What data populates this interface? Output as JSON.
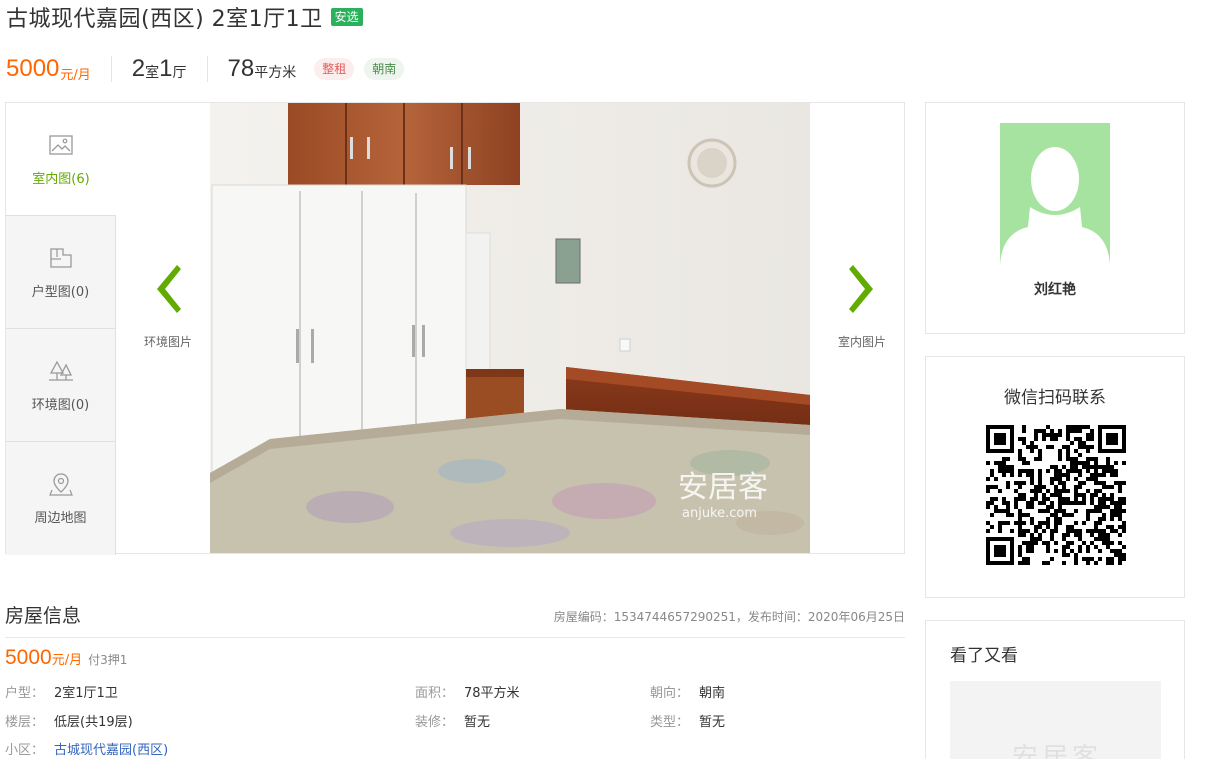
{
  "header": {
    "title": "古城现代嘉园(西区) 2室1厅1卫",
    "badge": "安选"
  },
  "summary": {
    "price": "5000",
    "price_unit": "元/月",
    "rooms_n1": "2",
    "rooms_u1": "室",
    "rooms_n2": "1",
    "rooms_u2": "厅",
    "area": "78",
    "area_unit": "平方米",
    "tags": [
      "整租",
      "朝南"
    ]
  },
  "gallery": {
    "tabs": [
      {
        "label": "室内图(6)",
        "icon": "picture-icon"
      },
      {
        "label": "户型图(0)",
        "icon": "floorplan-icon"
      },
      {
        "label": "环境图(0)",
        "icon": "trees-icon"
      },
      {
        "label": "周边地图",
        "icon": "map-pin-icon"
      }
    ],
    "prev_label": "环境图片",
    "next_label": "室内图片",
    "watermark_cn": "安居客",
    "watermark_en": "anjuke.com"
  },
  "agent": {
    "name": "刘红艳"
  },
  "wechat": {
    "title": "微信扫码联系"
  },
  "also_viewed": {
    "title": "看了又看",
    "watermark": "安居客"
  },
  "house_info": {
    "title": "房屋信息",
    "meta": "房屋编码：1534744657290251，发布时间：2020年06月25日",
    "price": "5000",
    "price_unit": "元/月",
    "pay": "付3押1",
    "fields": [
      {
        "label": "户型：",
        "value": "2室1厅1卫"
      },
      {
        "label": "面积：",
        "value": "78平方米"
      },
      {
        "label": "朝向：",
        "value": "朝南"
      },
      {
        "label": "楼层：",
        "value": "低层(共19层)"
      },
      {
        "label": "装修：",
        "value": "暂无"
      },
      {
        "label": "类型：",
        "value": "暂无"
      },
      {
        "label": "小区：",
        "value": "古城现代嘉园(西区)"
      }
    ]
  },
  "colors": {
    "accent_orange": "#ff6600",
    "accent_green": "#62ab00",
    "badge_green": "#2bb05c",
    "link_blue": "#3366bb"
  }
}
